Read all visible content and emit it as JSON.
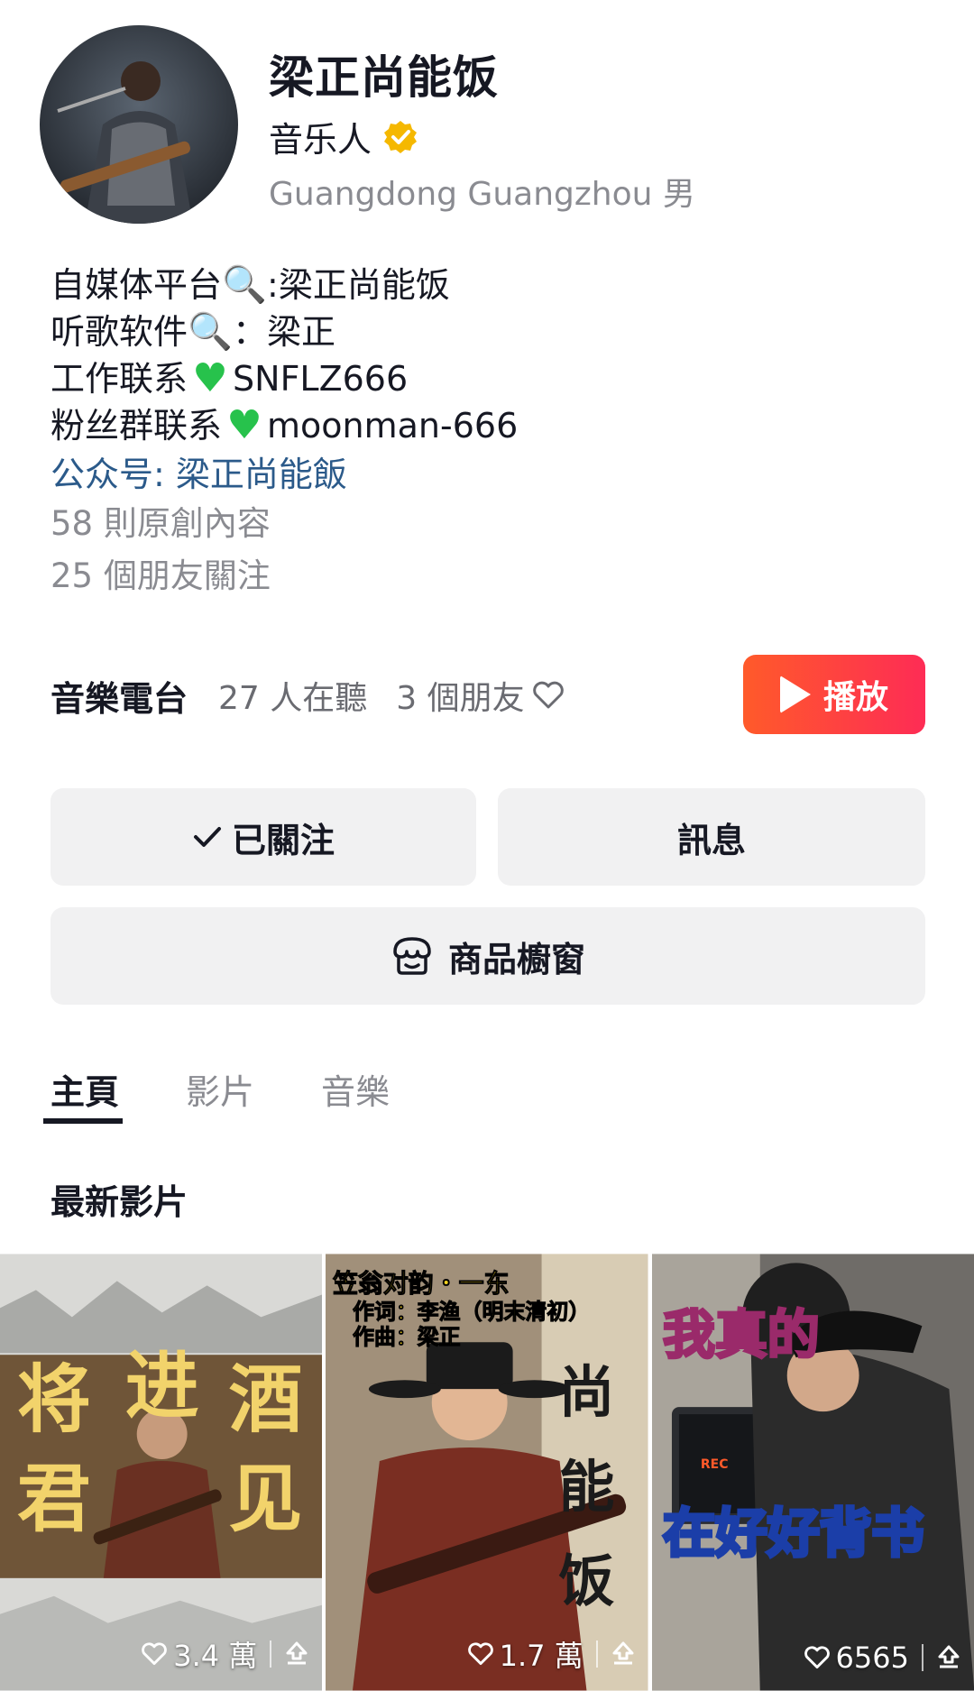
{
  "profile": {
    "name": "梁正尚能饭",
    "role": "音乐人",
    "location": "Guangdong Guangzhou 男"
  },
  "bio": {
    "line1_prefix": "自媒体平台",
    "line1_suffix": ":梁正尚能饭",
    "line2_prefix": "听歌软件",
    "line2_suffix": "：梁正",
    "line3_prefix": "工作联系",
    "line3_suffix": "SNFLZ666",
    "line4_prefix": "粉丝群联系",
    "line4_suffix": "moonman-666",
    "public_account": "公众号: 梁正尚能飯",
    "original_count": "58 則原創內容",
    "friends_following": "25 個朋友關注"
  },
  "radio": {
    "title": "音樂電台",
    "listeners": "27 人在聽",
    "friends": "3 個朋友",
    "play_label": "播放"
  },
  "actions": {
    "follow_label": "已關注",
    "message_label": "訊息",
    "shop_label": "商品櫥窗"
  },
  "tabs": [
    {
      "label": "主頁",
      "active": true
    },
    {
      "label": "影片",
      "active": false
    },
    {
      "label": "音樂",
      "active": false
    }
  ],
  "section_title": "最新影片",
  "videos": [
    {
      "likes": "3.4 萬",
      "caption_lines": [
        "将",
        "进",
        "酒",
        "君",
        "见"
      ]
    },
    {
      "likes": "1.7 萬",
      "caption_lines": [
        "笠翁对韵・一东",
        "作词：李渔（明末清初）",
        "作曲：梁正",
        "尚",
        "能",
        "饭"
      ]
    },
    {
      "likes": "6565",
      "caption_lines": [
        "我真的",
        "在好好背书",
        "REC"
      ]
    }
  ],
  "icons": {
    "verified": "verified-badge-icon",
    "search": "magnifier-icon",
    "green_heart": "green-heart-icon",
    "heart_outline": "heart-outline-icon",
    "check": "check-icon",
    "shop": "shop-icon",
    "play": "play-icon",
    "share": "share-icon"
  },
  "colors": {
    "play_button": "#fe2c55",
    "link": "#2b5a8a",
    "verified": "#f5b800",
    "green_heart": "#27c24c"
  }
}
